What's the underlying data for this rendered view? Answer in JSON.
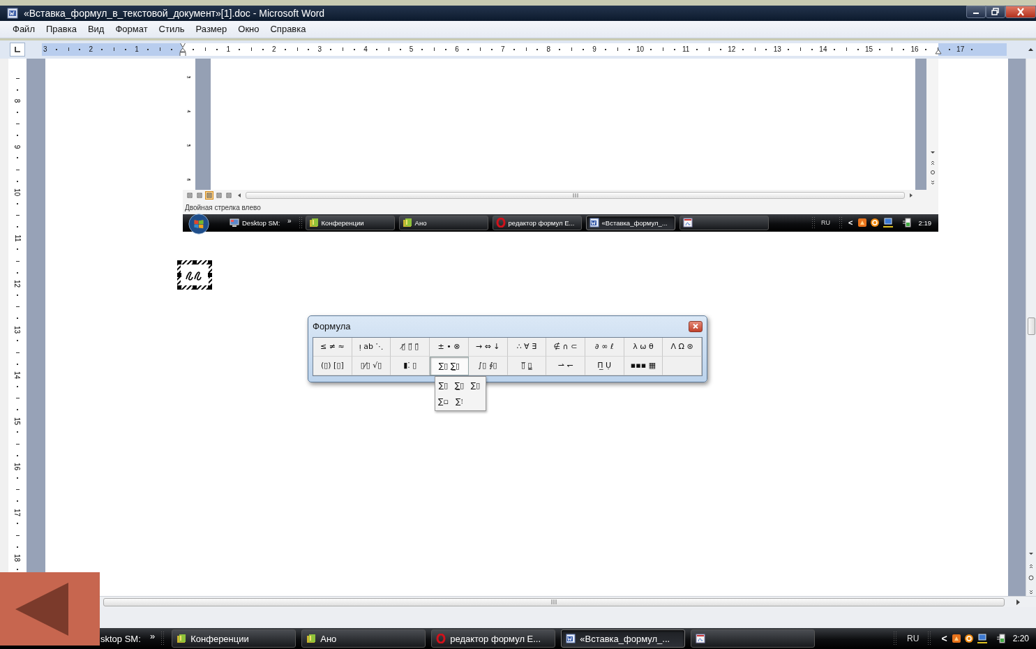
{
  "window": {
    "title": "«Вставка_формул_в_текстовой_документ»[1].doc - Microsoft Word"
  },
  "menu": [
    "Файл",
    "Правка",
    "Вид",
    "Формат",
    "Стиль",
    "Размер",
    "Окно",
    "Справка"
  ],
  "ruler": {
    "left_labels": [
      "3",
      "2",
      "1"
    ],
    "labels": [
      "1",
      "2",
      "3",
      "4",
      "5",
      "6",
      "7",
      "8",
      "9",
      "10",
      "11",
      "12",
      "13",
      "14",
      "15",
      "16",
      "17"
    ]
  },
  "vertical_ruler": [
    "8",
    "9",
    "10",
    "11",
    "12",
    "13",
    "14",
    "15",
    "16",
    "17",
    "18"
  ],
  "embedded_screenshot": {
    "vertical_ruler": [
      "3",
      "4",
      "5",
      "6"
    ],
    "view_buttons": [
      {
        "selected": false
      },
      {
        "selected": false
      },
      {
        "selected": true
      },
      {
        "selected": false
      },
      {
        "selected": false
      }
    ],
    "status_text": "Двойная стрелка влево",
    "taskbar": {
      "more": "»",
      "items": [
        {
          "kind": "desktop",
          "label": "Desktop SM:",
          "selected": false
        },
        {
          "kind": "folder",
          "label": "Конференции",
          "selected": false
        },
        {
          "kind": "folder",
          "label": "Ано",
          "selected": false
        },
        {
          "kind": "browser",
          "label": "редактор формул E...",
          "selected": false
        },
        {
          "kind": "document",
          "label": "«Вставка_формул_...",
          "selected": true
        },
        {
          "kind": "editor",
          "selected": false
        }
      ],
      "tray": {
        "language": "RU",
        "chevron": "<",
        "clock": "2:19"
      }
    }
  },
  "formula_palette": {
    "title": "Формула",
    "rows": [
      {
        "buttons": [
          {
            "symbols": "≤ ≠ ≈",
            "open": false
          },
          {
            "symbols": "ı̣ ab ⋱",
            "open": false
          },
          {
            "symbols": "▯̸ ▯⃗ ▯̈",
            "open": false
          },
          {
            "symbols": "± • ⊗",
            "open": false
          },
          {
            "symbols": "→ ⇔ ↓",
            "open": false
          },
          {
            "symbols": "∴ ∀ ∃",
            "open": false
          },
          {
            "symbols": "∉ ∩ ⊂",
            "open": false
          },
          {
            "symbols": "∂ ∞ ℓ",
            "open": false
          },
          {
            "symbols": "λ ω θ",
            "open": false
          },
          {
            "symbols": "Λ Ω ⊛",
            "open": false
          }
        ]
      },
      {
        "buttons": [
          {
            "symbols": "(▯) [▯]",
            "open": false
          },
          {
            "symbols": "▯⁄▯ √▯",
            "open": false
          },
          {
            "symbols": "▮⁚ ▯",
            "open": false
          },
          {
            "symbols": "∑▯ ∑̲▯",
            "open": true
          },
          {
            "symbols": "∫▯ ∮▯",
            "open": false
          },
          {
            "symbols": "▯̅ ▯̳",
            "open": false
          },
          {
            "symbols": "⇀ ↽",
            "open": false
          },
          {
            "symbols": "Π̲ Ụ",
            "open": false
          },
          {
            "symbols": "▪▪▪ ▦",
            "open": false
          }
        ]
      }
    ],
    "dropdown": [
      "∑▯",
      "∑̲▯",
      "∑̇▯",
      "∑▫",
      "∑⁝"
    ]
  },
  "taskbar": {
    "more": "»",
    "items": [
      {
        "kind": "desktop",
        "label": "sktop SM:",
        "selected": false
      },
      {
        "kind": "folder",
        "label": "Конференции",
        "selected": false
      },
      {
        "kind": "folder",
        "label": "Ано",
        "selected": false
      },
      {
        "kind": "browser",
        "label": "редактор формул E...",
        "selected": false
      },
      {
        "kind": "document",
        "label": "«Вставка_формул_...",
        "selected": true
      },
      {
        "kind": "editor",
        "selected": false
      }
    ],
    "tray": {
      "language": "RU",
      "chevron": "<",
      "clock": "2:20"
    }
  }
}
